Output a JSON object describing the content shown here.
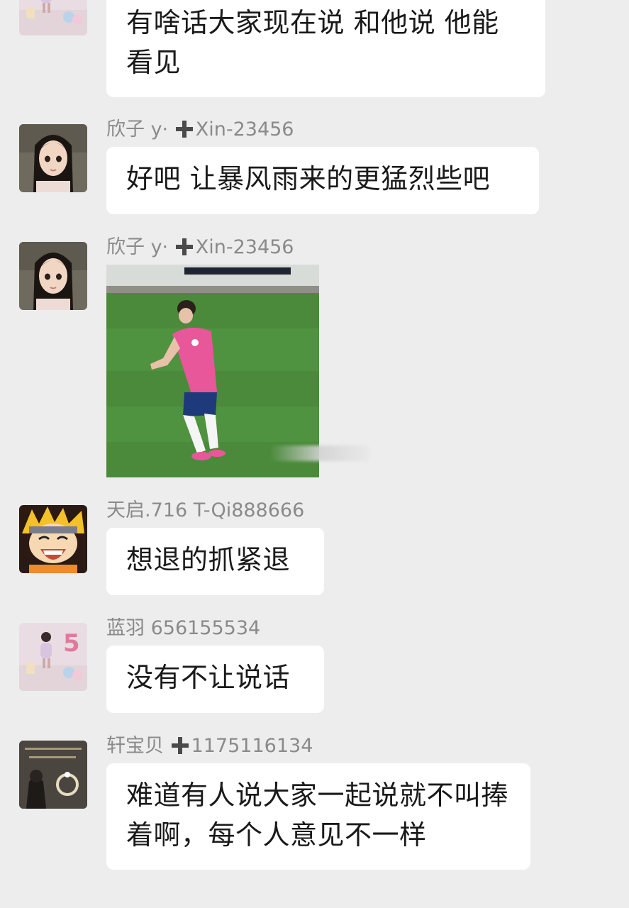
{
  "messages": [
    {
      "avatar_icon": "user-avatar-girl-party-icon",
      "text": "有啥话大家现在说 和他说 他能看见"
    },
    {
      "sender": {
        "name": "欣子 y· ",
        "tag": "Xin-23456"
      },
      "avatar_icon": "user-avatar-anime-girl-icon",
      "text": "好吧 让暴风雨来的更猛烈些吧"
    },
    {
      "sender": {
        "name": "欣子 y· ",
        "tag": "Xin-23456"
      },
      "avatar_icon": "user-avatar-anime-girl-icon",
      "image": "soccer-player-celebrating-photo"
    },
    {
      "sender": {
        "name": "天启.716 T-Qi888666"
      },
      "avatar_icon": "user-avatar-naruto-icon",
      "text": "想退的抓紧退"
    },
    {
      "sender": {
        "name": "蓝羽 656155534"
      },
      "avatar_icon": "user-avatar-girl-party-icon",
      "text": "没有不让说话"
    },
    {
      "sender": {
        "name": "轩宝贝 ",
        "tag": "1175116134"
      },
      "avatar_icon": "user-avatar-ring-photo-icon",
      "text": "难道有人说大家一起说就不叫捧着啊，每个人意见不一样"
    }
  ],
  "colors": {
    "background": "#ededed",
    "bubble": "#ffffff",
    "sender_text": "#8a8a8a",
    "message_text": "#1a1a1a"
  }
}
